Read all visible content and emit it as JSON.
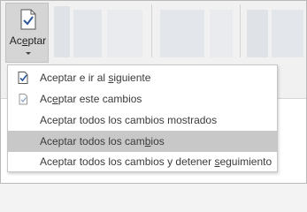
{
  "ribbon": {
    "accept_button": {
      "label_before": "Ac",
      "label_mnemonic": "e",
      "label_after": "ptar",
      "icon": "document-check-icon",
      "dropdown_icon": "chevron-down-icon"
    }
  },
  "menu": {
    "items": [
      {
        "before": "Aceptar e ir al ",
        "mnemonic": "s",
        "after": "iguiente",
        "icon": "document-check-icon",
        "highlighted": false
      },
      {
        "before": "Ac",
        "mnemonic": "e",
        "after": "ptar este cambios",
        "icon": "document-check-small-icon",
        "highlighted": false
      },
      {
        "before": "Aceptar todos los cambios mostrados",
        "mnemonic": "",
        "after": "",
        "icon": "",
        "highlighted": false
      },
      {
        "before": "Aceptar todos los cam",
        "mnemonic": "b",
        "after": "ios",
        "icon": "",
        "highlighted": true
      },
      {
        "before": "Aceptar todos los cambios y detener ",
        "mnemonic": "s",
        "after": "eguimiento",
        "icon": "",
        "highlighted": false
      }
    ]
  },
  "colors": {
    "highlight": "#c8c8c8",
    "check_accent": "#2b579a",
    "menu_border": "#c6c6c6"
  }
}
